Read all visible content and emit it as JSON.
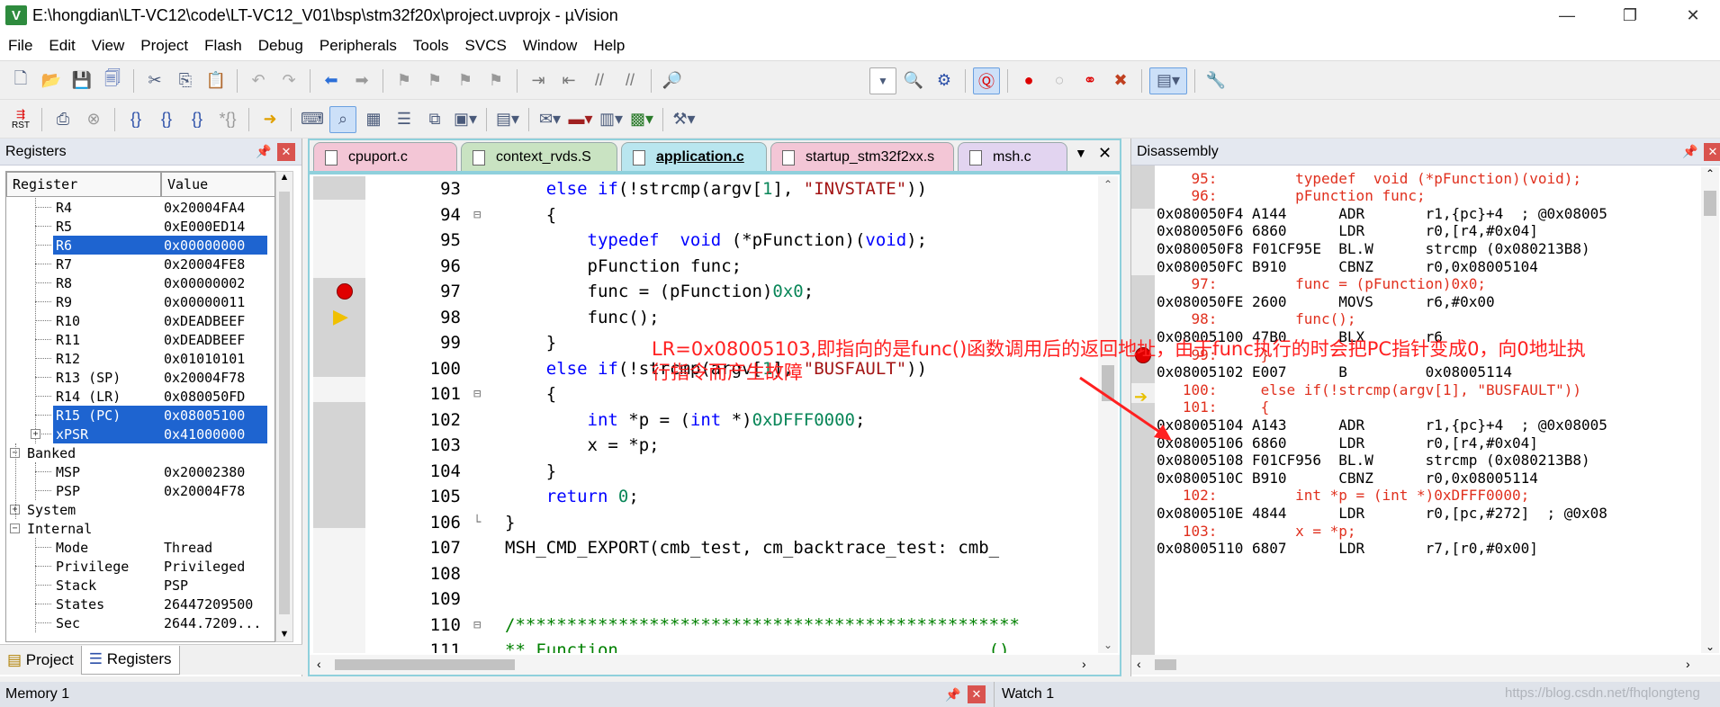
{
  "window": {
    "title": "E:\\hongdian\\LT-VC12\\code\\LT-VC12_V01\\bsp\\stm32f20x\\project.uvprojx - µVision",
    "icon_letter": "V"
  },
  "menu": [
    "File",
    "Edit",
    "View",
    "Project",
    "Flash",
    "Debug",
    "Peripherals",
    "Tools",
    "SVCS",
    "Window",
    "Help"
  ],
  "toolbar1_icons": [
    "new-file-icon",
    "open-folder-icon",
    "save-icon",
    "save-all-icon",
    "cut-icon",
    "copy-icon",
    "paste-icon",
    "undo-icon",
    "redo-icon",
    "nav-back-icon",
    "nav-forward-icon",
    "bookmark-icon",
    "bookmark-prev-icon",
    "bookmark-next-icon",
    "bookmark-clear-icon",
    "indent-icon",
    "unindent-icon",
    "comment-icon",
    "uncomment-icon",
    "find-in-files-icon"
  ],
  "toolbar2_icons": [
    "reset-icon",
    "run-icon",
    "stop-icon",
    "step-into-icon",
    "step-over-icon",
    "step-out-icon",
    "run-to-cursor-icon",
    "show-next-statement-icon",
    "command-window-icon",
    "disassembly-window-icon",
    "symbols-window-icon",
    "registers-window-icon",
    "call-stack-icon",
    "watch-window-icon",
    "memory-window-icon",
    "serial-window-icon",
    "analysis-window-icon",
    "trace-window-icon",
    "system-viewer-icon",
    "toolbox-icon"
  ],
  "toolbar2_reset_label": "RST",
  "registers_panel": {
    "title": "Registers",
    "col_register": "Register",
    "col_value": "Value",
    "rows": [
      {
        "name": "R4",
        "value": "0x20004FA4",
        "selected": false
      },
      {
        "name": "R5",
        "value": "0xE000ED14",
        "selected": false
      },
      {
        "name": "R6",
        "value": "0x00000000",
        "selected": true
      },
      {
        "name": "R7",
        "value": "0x20004FE8",
        "selected": false
      },
      {
        "name": "R8",
        "value": "0x00000002",
        "selected": false
      },
      {
        "name": "R9",
        "value": "0x00000011",
        "selected": false
      },
      {
        "name": "R10",
        "value": "0xDEADBEEF",
        "selected": false
      },
      {
        "name": "R11",
        "value": "0xDEADBEEF",
        "selected": false
      },
      {
        "name": "R12",
        "value": "0x01010101",
        "selected": false
      },
      {
        "name": "R13 (SP)",
        "value": "0x20004F78",
        "selected": false
      },
      {
        "name": "R14 (LR)",
        "value": "0x080050FD",
        "selected": false
      },
      {
        "name": "R15 (PC)",
        "value": "0x08005100",
        "selected": true
      },
      {
        "name": "xPSR",
        "value": "0x41000000",
        "selected": true
      }
    ],
    "banked_label": "Banked",
    "banked_rows": [
      {
        "name": "MSP",
        "value": "0x20002380"
      },
      {
        "name": "PSP",
        "value": "0x20004F78"
      }
    ],
    "system_label": "System",
    "internal_label": "Internal",
    "internal_rows": [
      {
        "name": "Mode",
        "value": "Thread"
      },
      {
        "name": "Privilege",
        "value": "Privileged"
      },
      {
        "name": "Stack",
        "value": "PSP"
      },
      {
        "name": "States",
        "value": "26447209500"
      },
      {
        "name": "Sec",
        "value": "2644.7209..."
      }
    ],
    "tab_project": "Project",
    "tab_registers": "Registers"
  },
  "editor": {
    "tabs": [
      {
        "label": "cpuport.c",
        "active": false,
        "color": "#f3c6d6"
      },
      {
        "label": "context_rvds.S",
        "active": false,
        "color": "#c9e3c2"
      },
      {
        "label": "application.c",
        "active": true,
        "color": "#b9e6ef"
      },
      {
        "label": "startup_stm32f2xx.s",
        "active": false,
        "color": "#f3c6d6"
      },
      {
        "label": "msh.c",
        "active": false,
        "color": "#e2d4f0"
      }
    ],
    "lines": [
      {
        "n": "93",
        "html": "    <span class='kw'>else if</span>(!strcmp(argv[<span class='num'>1</span>], <span class='str'>\"INVSTATE\"</span>))"
      },
      {
        "n": "94",
        "html": "    {"
      },
      {
        "n": "95",
        "html": "        <span class='kw'>typedef</span>  <span class='kw'>void</span> (*pFunction)(<span class='kw'>void</span>);"
      },
      {
        "n": "96",
        "html": "        pFunction func;"
      },
      {
        "n": "97",
        "html": "        func = (pFunction)<span class='num'>0x0</span>;"
      },
      {
        "n": "98",
        "html": "        func();"
      },
      {
        "n": "99",
        "html": "    }"
      },
      {
        "n": "100",
        "html": "    <span class='kw'>else if</span>(!strcmp(argv[<span class='num'>1</span>], <span class='str'>\"BUSFAULT\"</span>))"
      },
      {
        "n": "101",
        "html": "    {"
      },
      {
        "n": "102",
        "html": "        <span class='kw'>int</span> *p = (<span class='kw'>int</span> *)<span class='num'>0xDFFF0000</span>;"
      },
      {
        "n": "103",
        "html": "        x = *p;"
      },
      {
        "n": "104",
        "html": "    }"
      },
      {
        "n": "105",
        "html": "    <span class='kw'>return</span> <span class='num'>0</span>;"
      },
      {
        "n": "106",
        "html": "}"
      },
      {
        "n": "107",
        "html": "MSH_CMD_EXPORT(cmb_test, cm_backtrace_test: cmb_"
      },
      {
        "n": "108",
        "html": ""
      },
      {
        "n": "109",
        "html": ""
      },
      {
        "n": "110",
        "html": "<span class='cmt'>/*************************************************</span>"
      },
      {
        "n": "111",
        "html": "<span class='cmt'>** Function                                    ()</span>"
      }
    ]
  },
  "annotation": {
    "line1": "LR=0x08005103,即指向的是func()函数调用后的返回地址，由于func执行的时会把PC指针变成0，向0地址执",
    "line2": "行指令而产生故障",
    "color": "#ff2020"
  },
  "disassembly": {
    "title": "Disassembly",
    "rows": [
      {
        "src": true,
        "text": "    95:         typedef  void (*pFunction)(void);"
      },
      {
        "src": true,
        "text": "    96:         pFunction func;"
      },
      {
        "src": false,
        "text": "0x080050F4 A144      ADR       r1,{pc}+4  ; @0x08005"
      },
      {
        "src": false,
        "text": "0x080050F6 6860      LDR       r0,[r4,#0x04]"
      },
      {
        "src": false,
        "text": "0x080050F8 F01CF95E  BL.W      strcmp (0x080213B8)"
      },
      {
        "src": false,
        "text": "0x080050FC B910      CBNZ      r0,0x08005104"
      },
      {
        "src": true,
        "text": "    97:         func = (pFunction)0x0;"
      },
      {
        "src": false,
        "text": "0x080050FE 2600      MOVS      r6,#0x00"
      },
      {
        "src": true,
        "text": "    98:         func();"
      },
      {
        "src": false,
        "text": "0x08005100 47B0      BLX       r6"
      },
      {
        "src": true,
        "text": "    99:     }"
      },
      {
        "src": false,
        "text": "0x08005102 E007      B         0x08005114"
      },
      {
        "src": true,
        "text": "   100:     else if(!strcmp(argv[1], \"BUSFAULT\"))"
      },
      {
        "src": true,
        "text": "   101:     {"
      },
      {
        "src": false,
        "text": "0x08005104 A143      ADR       r1,{pc}+4  ; @0x08005"
      },
      {
        "src": false,
        "text": "0x08005106 6860      LDR       r0,[r4,#0x04]"
      },
      {
        "src": false,
        "text": "0x08005108 F01CF956  BL.W      strcmp (0x080213B8)"
      },
      {
        "src": false,
        "text": "0x0800510C B910      CBNZ      r0,0x08005114"
      },
      {
        "src": true,
        "text": "   102:         int *p = (int *)0xDFFF0000;"
      },
      {
        "src": false,
        "text": "0x0800510E 4844      LDR       r0,[pc,#272]  ; @0x08"
      },
      {
        "src": true,
        "text": "   103:         x = *p;"
      },
      {
        "src": false,
        "text": "0x08005110 6807      LDR       r7,[r0,#0x00]"
      }
    ]
  },
  "bottom": {
    "memory_title": "Memory 1",
    "watch_title": "Watch 1",
    "watermark": "https://blog.csdn.net/fhqlongteng"
  }
}
